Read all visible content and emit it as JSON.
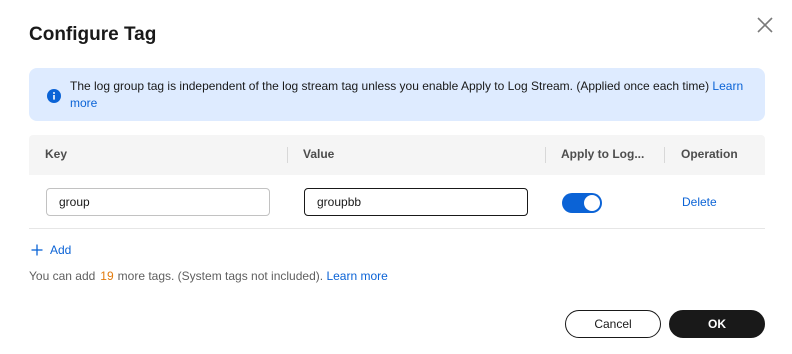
{
  "dialog": {
    "title": "Configure Tag",
    "close_icon": "close-icon"
  },
  "notice": {
    "icon": "info-icon",
    "text": "The log group tag is independent of the log stream tag unless you enable Apply to Log Stream. (Applied once each time)",
    "link": "Learn more"
  },
  "table": {
    "columns": [
      "Key",
      "Value",
      "Apply to Log...",
      "Operation"
    ],
    "rows": [
      {
        "key": "group",
        "value": "groupbb",
        "apply_to_log_stream": true,
        "operation": "Delete"
      }
    ]
  },
  "add": {
    "icon": "plus-icon",
    "label": "Add"
  },
  "hint": {
    "prefix": "You can add",
    "count": "19",
    "suffix": "more tags. (System tags not included).",
    "link": "Learn more"
  },
  "footer": {
    "cancel_label": "Cancel",
    "ok_label": "OK"
  },
  "colors": {
    "accent": "#0b63d6",
    "notice_bg": "#deebff",
    "count": "#e27b0d",
    "primary_button": "#191919"
  }
}
